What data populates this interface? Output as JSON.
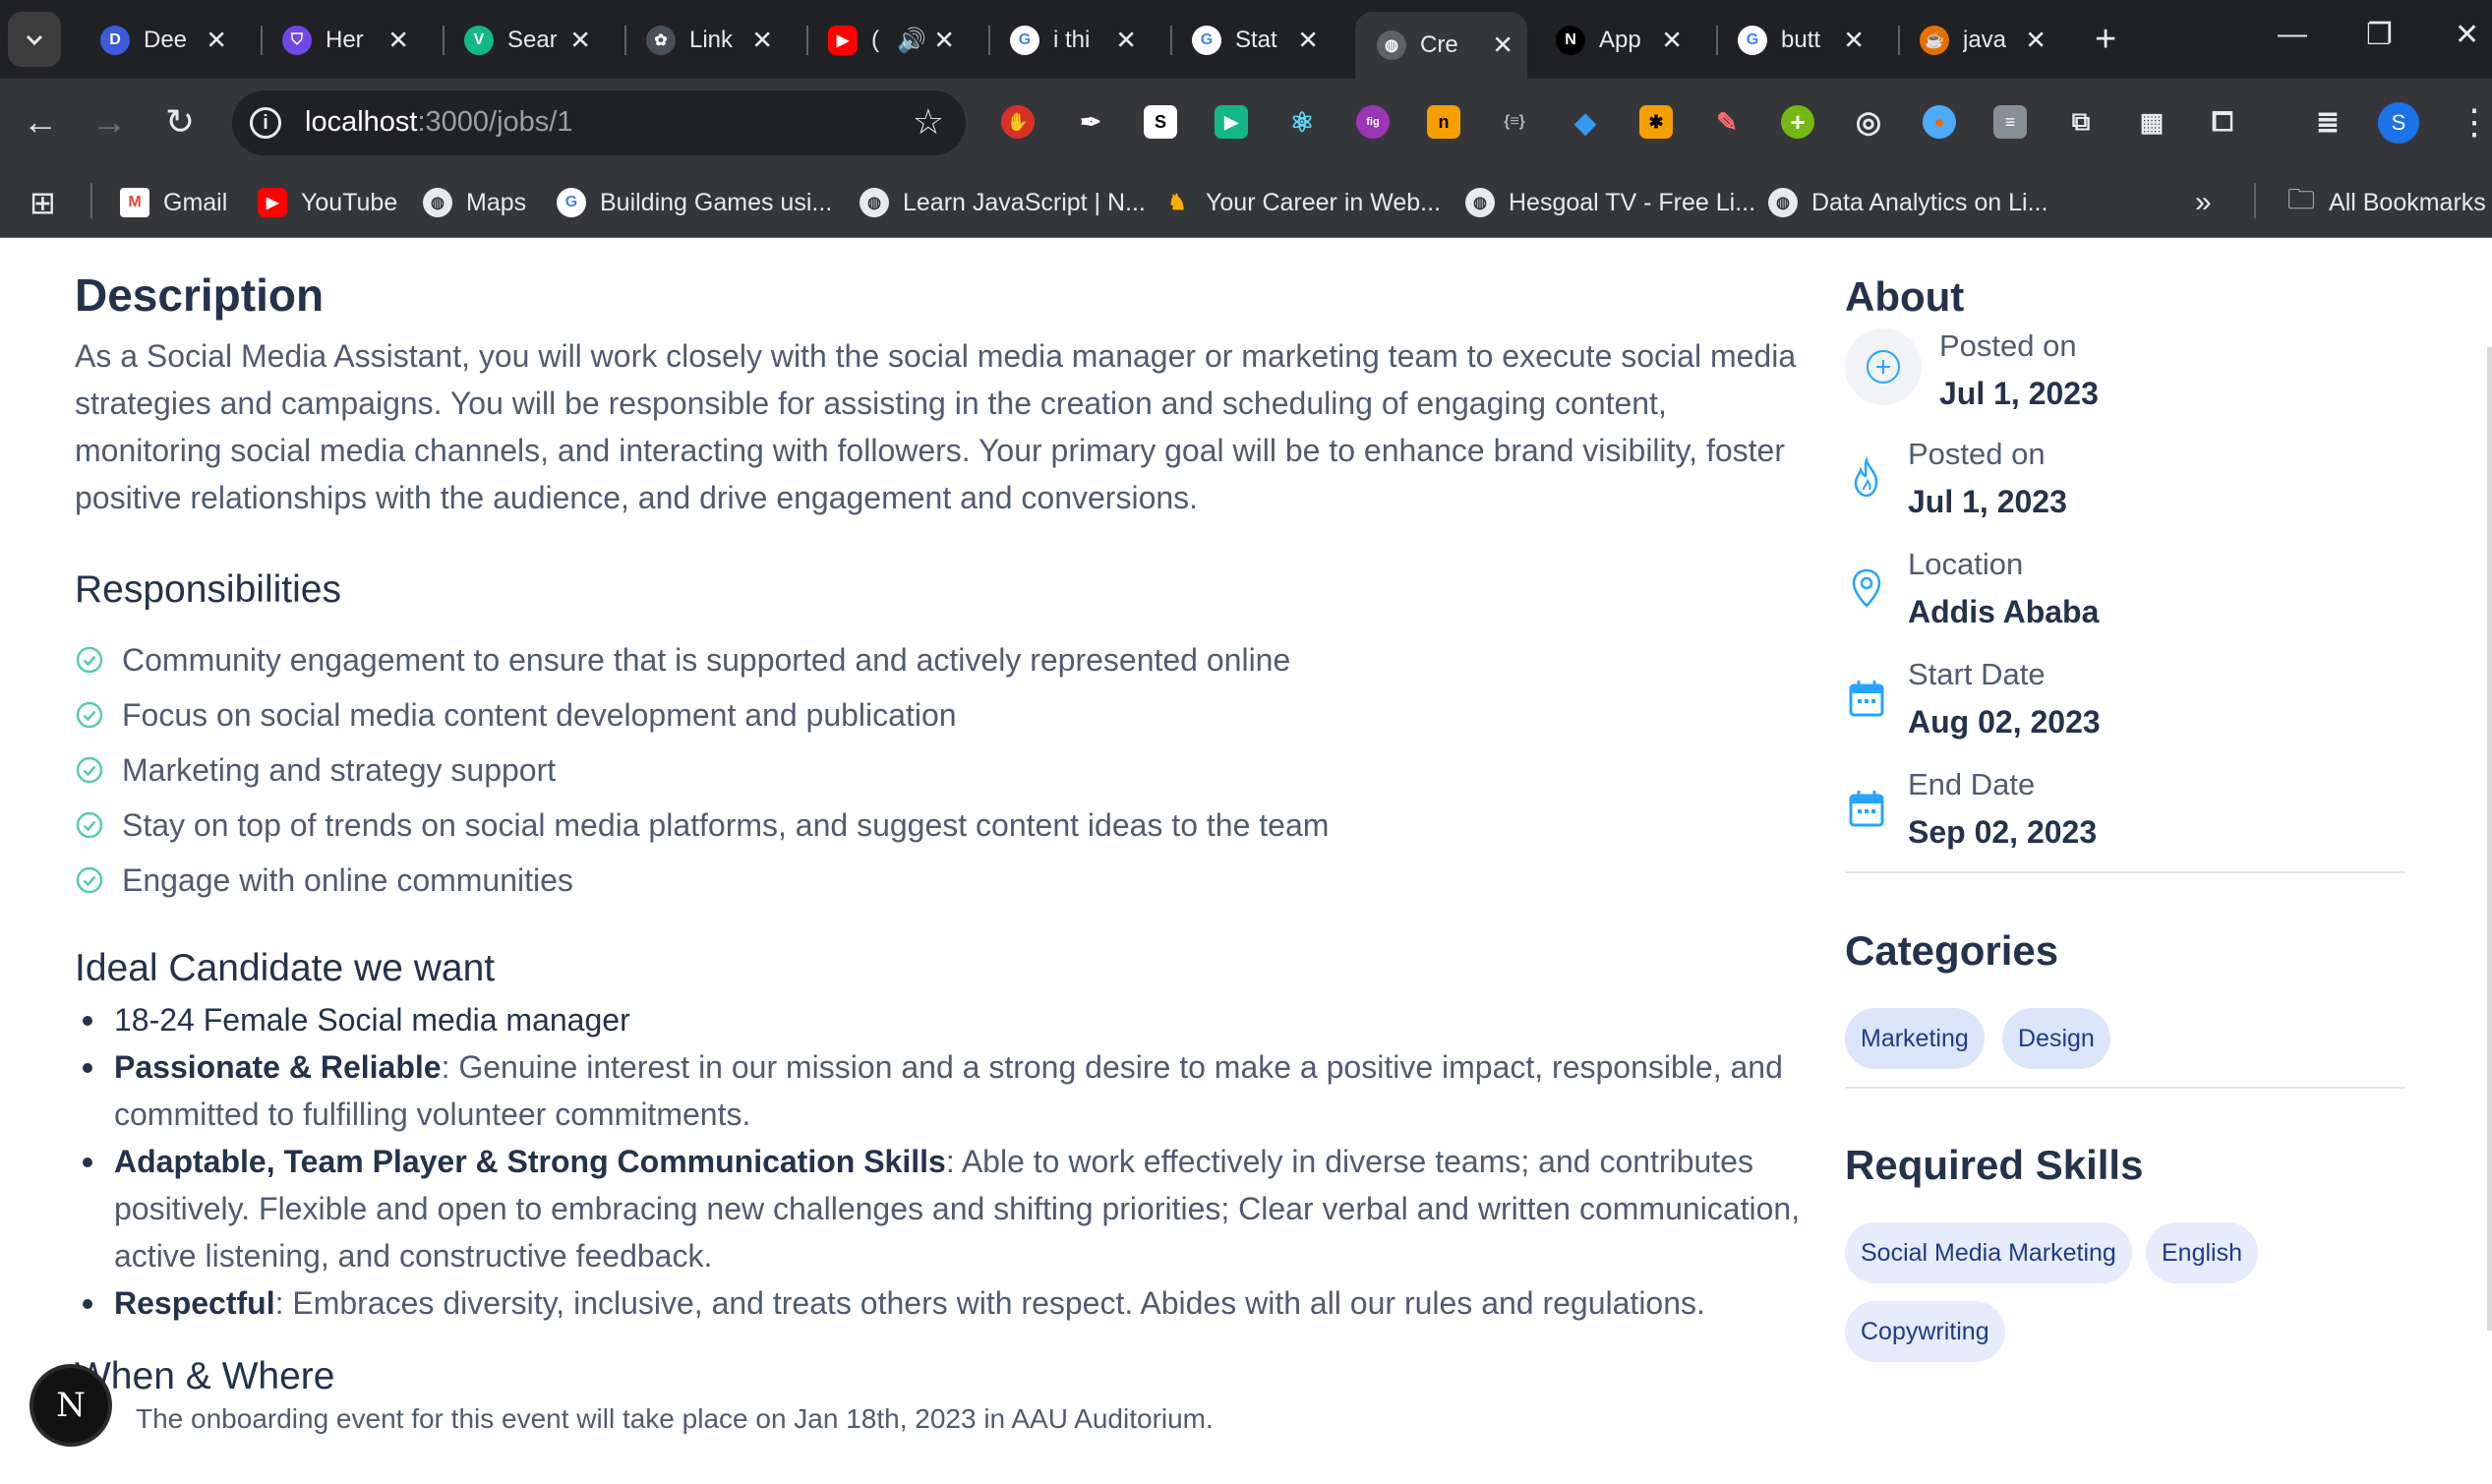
{
  "browser": {
    "tabs": [
      {
        "title": "Dee",
        "icon": "deepl-icon",
        "color": "#3b5bdb"
      },
      {
        "title": "Her",
        "icon": "shield-icon",
        "color": "#7048e8"
      },
      {
        "title": "Sear",
        "icon": "vuetify-icon",
        "color": "#12b886"
      },
      {
        "title": "Link",
        "icon": "openai-icon",
        "color": "#495057"
      },
      {
        "title": "(",
        "icon": "youtube-icon",
        "color": "#ff0000"
      },
      {
        "title": "i thi",
        "icon": "google-icon",
        "color": "#4285f4"
      },
      {
        "title": "Stat",
        "icon": "google-icon",
        "color": "#4285f4"
      },
      {
        "title": "Cre",
        "icon": "globe-icon",
        "color": "#5f6368"
      },
      {
        "title": "App",
        "icon": "nextjs-icon",
        "color": "#000000"
      },
      {
        "title": "butt",
        "icon": "google-icon",
        "color": "#4285f4"
      },
      {
        "title": "java",
        "icon": "java-icon",
        "color": "#e76f00"
      }
    ],
    "new_tab_label": "+",
    "url_host": "localhost",
    "url_path": ":3000/jobs/1",
    "profile_initial": "S",
    "bookmarks": [
      {
        "label": "Gmail",
        "icon": "gmail-icon"
      },
      {
        "label": "YouTube",
        "icon": "youtube-icon"
      },
      {
        "label": "Maps",
        "icon": "globe-icon"
      },
      {
        "label": "Building Games usi...",
        "icon": "google-icon"
      },
      {
        "label": "Learn JavaScript | N...",
        "icon": "globe-icon"
      },
      {
        "label": "Your Career in Web...",
        "icon": "viking-icon"
      },
      {
        "label": "Hesgoal TV - Free Li...",
        "icon": "globe-icon"
      },
      {
        "label": "Data Analytics on Li...",
        "icon": "globe-icon"
      }
    ],
    "all_bookmarks_label": "All Bookmarks"
  },
  "job": {
    "description_title": "Description",
    "description_text": "As a Social Media Assistant, you will work closely with the social media manager or marketing team to execute social media strategies and campaigns. You will be responsible for assisting in the creation and scheduling of engaging content, monitoring social media channels, and interacting with followers. Your primary goal will be to enhance brand visibility, foster positive relationships with the audience, and drive engagement and conversions.",
    "responsibilities_title": "Responsibilities",
    "responsibilities": [
      "Community engagement to ensure that is supported and actively represented online",
      "Focus on social media content development and publication",
      "Marketing and strategy support",
      "Stay on top of trends on social media platforms, and suggest content ideas to the team",
      "Engage with online communities"
    ],
    "ideal_title": "Ideal Candidate we want",
    "ideal_intro": "18-24 Female Social media manager",
    "ideal_traits": [
      {
        "name": "Passionate & Reliable",
        "text": ": Genuine interest in our mission and a strong desire to make a positive impact, responsible, and committed to fulfilling volunteer commitments."
      },
      {
        "name": "Adaptable, Team Player & Strong Communication Skills",
        "text": ": Able to work effectively in diverse teams; and contributes positively. Flexible and open to embracing new challenges and shifting priorities; Clear verbal and written communication, active listening, and constructive feedback."
      },
      {
        "name": "Respectful",
        "text": ": Embraces diversity, inclusive, and treats others with respect. Abides with all our rules and regulations."
      }
    ],
    "when_title": "When & Where",
    "when_text": "The onboarding event for this event will take place on Jan 18th, 2023 in AAU Auditorium."
  },
  "sidebar": {
    "about_title": "About",
    "about": [
      {
        "label": "Posted on",
        "value": "Jul 1, 2023",
        "icon": "plus-circle-icon"
      },
      {
        "label": "Posted on",
        "value": "Jul 1, 2023",
        "icon": "fire-icon"
      },
      {
        "label": "Location",
        "value": "Addis Ababa",
        "icon": "location-pin-icon"
      },
      {
        "label": "Start Date",
        "value": "Aug 02, 2023",
        "icon": "calendar-icon"
      },
      {
        "label": "End Date",
        "value": "Sep 02, 2023",
        "icon": "calendar-icon"
      }
    ],
    "categories_title": "Categories",
    "categories": [
      "Marketing",
      "Design"
    ],
    "skills_title": "Required Skills",
    "skills": [
      "Social Media Marketing",
      "English",
      "Copywriting"
    ]
  },
  "devtools_badge": "N",
  "colors": {
    "accent": "#26a4ff",
    "check": "#56cdad",
    "heading": "#25324b",
    "body": "#515b6f",
    "chip_bg": "#e6ecfb",
    "chip_text": "#1f3a8a"
  }
}
